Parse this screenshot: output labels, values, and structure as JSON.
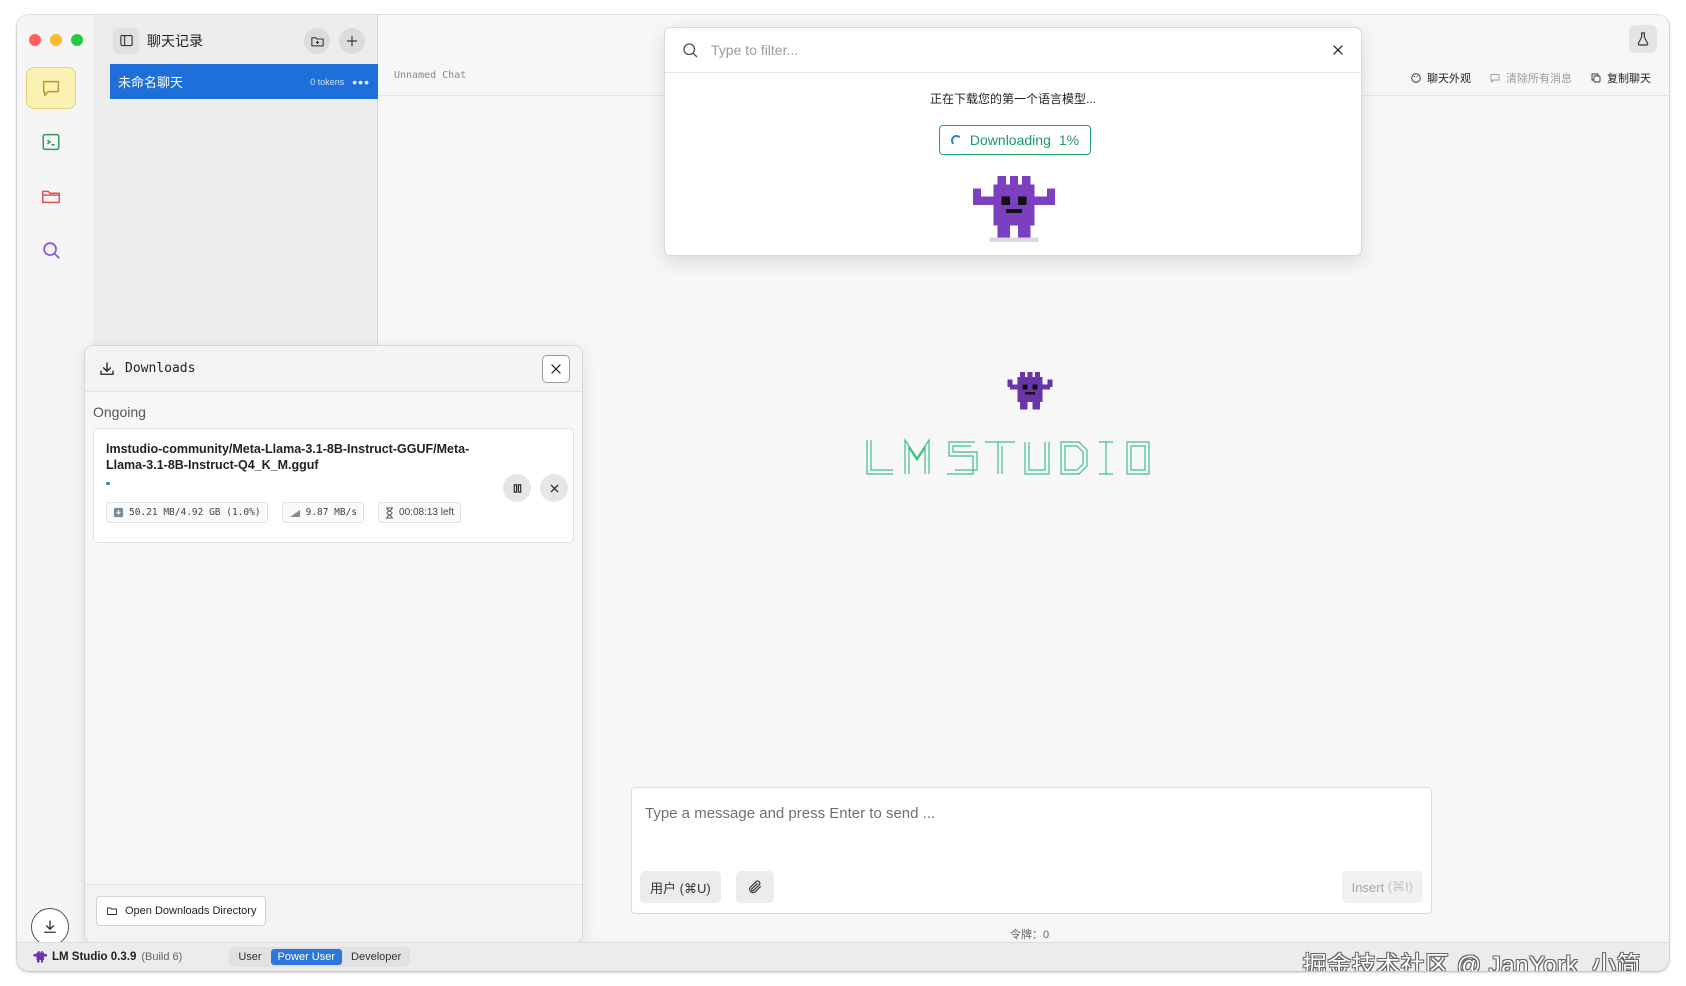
{
  "sidebar_history": {
    "title": "聊天记录",
    "chat": {
      "name": "未命名聊天",
      "tokens": "0 tokens",
      "more": "•••"
    }
  },
  "topbar": {
    "chat_title": "Unnamed Chat",
    "actions": [
      {
        "label": "聊天外观"
      },
      {
        "label": "清除所有消息"
      },
      {
        "label": "复制聊天"
      }
    ]
  },
  "filter_popup": {
    "placeholder": "Type to filter...",
    "message": "正在下载您的第一个语言模型...",
    "status_label": "Downloading",
    "percent": "1%"
  },
  "composer": {
    "placeholder": "Type a message and press Enter to send ...",
    "role_button": "用户 (⌘U)",
    "insert_button": "Insert",
    "insert_shortcut": "(⌘I)",
    "token_count": "令牌：0"
  },
  "downloads": {
    "title": "Downloads",
    "section": "Ongoing",
    "item": {
      "file": "lmstudio-community/Meta-Llama-3.1-8B-Instruct-GGUF/Meta-Llama-3.1-8B-Instruct-Q4_K_M.gguf",
      "progress": 0.01,
      "size": "50.21 MB/4.92 GB (1.0%)",
      "speed": "9.87 MB/s",
      "eta": "00:08:13 left"
    },
    "open_dir": "Open Downloads Directory"
  },
  "statusbar": {
    "app_name": "LM Studio 0.3.9",
    "build": "(Build 6)",
    "modes": [
      "User",
      "Power User",
      "Developer"
    ],
    "active_mode": "Power User",
    "watermark": "掘金技术社区 @ JanYork_小简"
  },
  "colors": {
    "accent_blue": "#1e6fd9",
    "download_green": "#1a9b60",
    "mascot_purple": "#7b3fbf",
    "logo_green": "#3ec08a"
  }
}
